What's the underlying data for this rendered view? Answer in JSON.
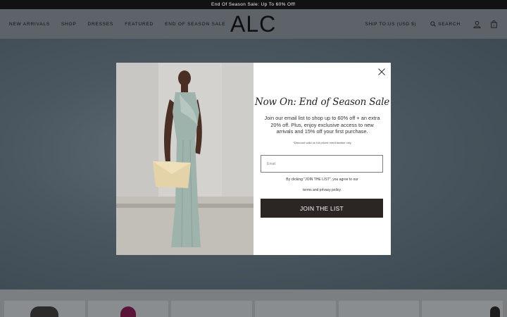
{
  "announcement": {
    "text": "End Of Season Sale: Up To 60% Off!"
  },
  "header": {
    "nav": [
      "NEW ARRIVALS",
      "SHOP",
      "DRESSES",
      "FEATURED",
      "END OF SEASON SALE"
    ],
    "logo": "ALC",
    "ship_to": "SHIP TO:US (USD $)",
    "search_label": "SEARCH",
    "icons": {
      "search": "search-icon",
      "account": "account-icon",
      "bag": "shopping-bag-icon"
    }
  },
  "modal": {
    "headline": "Now On: End of Season Sale",
    "body": "Join our email list to shop up to 60% off + an extra 20% off. Plus, enjoy exclusive access to new arrivals and 15% off your first purchase.",
    "disclaimer": "*Discount valid on full priced merchandise only",
    "email_placeholder": "Email",
    "legal_line1": "By clicking \"JOIN THE LIST\", you agree to our",
    "legal_line2": "terms and privacy policy.",
    "cta": "JOIN THE LIST",
    "close_icon": "close-icon"
  },
  "colors": {
    "announcement_bg": "#121212",
    "cta_bg": "#2b2523",
    "overlay": "#56626a",
    "dress": "#9fb3ad"
  }
}
